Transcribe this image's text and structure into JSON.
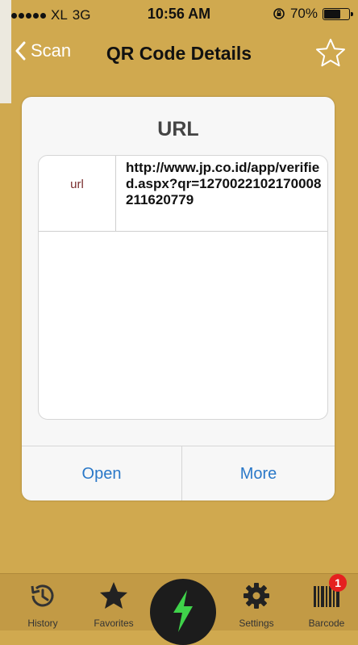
{
  "status_bar": {
    "carrier": "XL",
    "network": "3G",
    "time": "10:56 AM",
    "battery": "70%",
    "battery_level": 0.7
  },
  "nav": {
    "back_label": "Scan",
    "title": "QR Code Details",
    "favorite_icon": "star-outline-icon"
  },
  "card": {
    "title": "URL",
    "rows": [
      {
        "key": "url",
        "value": "http://www.jp.co.id/app/verified.aspx?qr=1270022102170008211620779"
      }
    ],
    "actions": {
      "open": "Open",
      "more": "More"
    }
  },
  "tabbar": {
    "history": "History",
    "favorites": "Favorites",
    "settings": "Settings",
    "barcode": "Barcode",
    "barcode_badge": "1"
  },
  "colors": {
    "background": "#d0a94f",
    "tabbar": "#c29a45",
    "link": "#2a78c8",
    "key_text": "#7a2e2e",
    "scan_bolt": "#3fd24a",
    "badge": "#e5211f"
  }
}
